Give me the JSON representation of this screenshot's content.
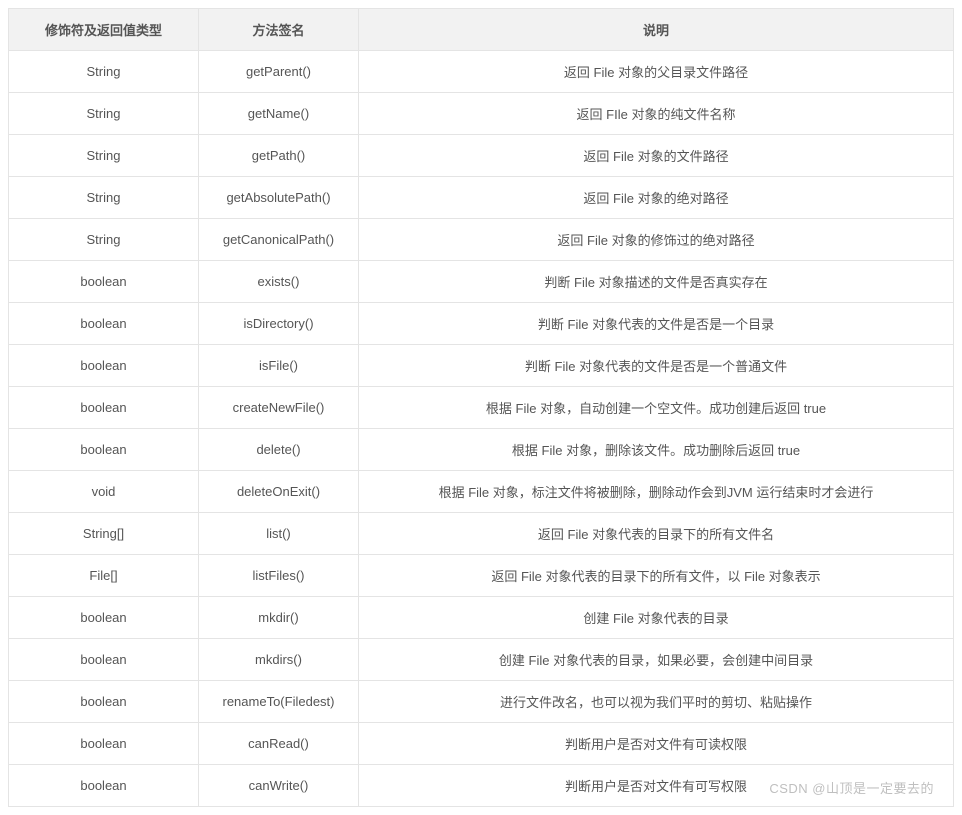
{
  "headers": [
    "修饰符及返回值类型",
    "方法签名",
    "说明"
  ],
  "rows": [
    {
      "ret": "String",
      "sig": "getParent()",
      "desc": "返回 File 对象的父目录文件路径"
    },
    {
      "ret": "String",
      "sig": "getName()",
      "desc": "返回 FIle 对象的纯文件名称"
    },
    {
      "ret": "String",
      "sig": "getPath()",
      "desc": "返回 File 对象的文件路径"
    },
    {
      "ret": "String",
      "sig": "getAbsolutePath()",
      "desc": "返回 File 对象的绝对路径"
    },
    {
      "ret": "String",
      "sig": "getCanonicalPath()",
      "desc": "返回 File 对象的修饰过的绝对路径"
    },
    {
      "ret": "boolean",
      "sig": "exists()",
      "desc": "判断 File 对象描述的文件是否真实存在"
    },
    {
      "ret": "boolean",
      "sig": "isDirectory()",
      "desc": "判断 File 对象代表的文件是否是一个目录"
    },
    {
      "ret": "boolean",
      "sig": "isFile()",
      "desc": "判断 File 对象代表的文件是否是一个普通文件"
    },
    {
      "ret": "boolean",
      "sig": "createNewFile()",
      "desc": "根据 File 对象，自动创建一个空文件。成功创建后返回 true"
    },
    {
      "ret": "boolean",
      "sig": "delete()",
      "desc": "根据 File 对象，删除该文件。成功删除后返回 true"
    },
    {
      "ret": "void",
      "sig": "deleteOnExit()",
      "desc": "根据 File 对象，标注文件将被删除，删除动作会到JVM 运行结束时才会进行"
    },
    {
      "ret": "String[]",
      "sig": "list()",
      "desc": "返回 File 对象代表的目录下的所有文件名"
    },
    {
      "ret": "File[]",
      "sig": "listFiles()",
      "desc": "返回 File 对象代表的目录下的所有文件，以 File 对象表示"
    },
    {
      "ret": "boolean",
      "sig": "mkdir()",
      "desc": "创建 File 对象代表的目录"
    },
    {
      "ret": "boolean",
      "sig": "mkdirs()",
      "desc": "创建 File 对象代表的目录，如果必要，会创建中间目录"
    },
    {
      "ret": "boolean",
      "sig": "renameTo(Filedest)",
      "desc": "进行文件改名，也可以视为我们平时的剪切、粘贴操作"
    },
    {
      "ret": "boolean",
      "sig": "canRead()",
      "desc": "判断用户是否对文件有可读权限"
    },
    {
      "ret": "boolean",
      "sig": "canWrite()",
      "desc": "判断用户是否对文件有可写权限"
    }
  ],
  "watermark": "CSDN @山顶是一定要去的"
}
